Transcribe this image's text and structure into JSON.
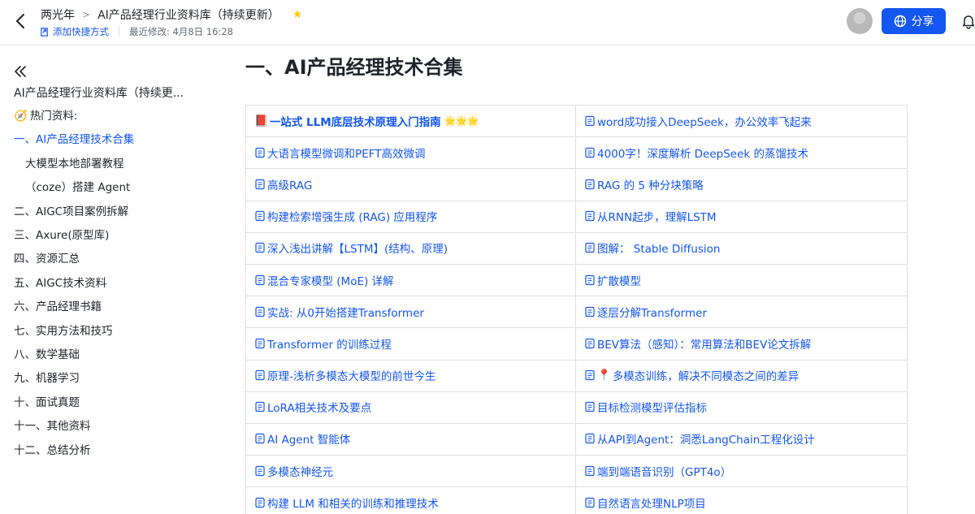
{
  "header": {
    "parent": "两光年",
    "separator": ">",
    "title": "AI产品经理行业资料库（持续更新）",
    "star": "★",
    "shortcut_label": "添加快捷方式",
    "modified": "最近修改: 4月8日 16:28",
    "share_label": "分享"
  },
  "sidebar": {
    "doc_title": "AI产品经理行业资料库（持续更...",
    "items": [
      {
        "label": "热门资料:",
        "icon": "🧭"
      },
      {
        "label": "一、AI产品经理技术合集"
      },
      {
        "label": "大模型本地部署教程"
      },
      {
        "label": "（coze）搭建 Agent"
      },
      {
        "label": "二、AIGC项目案例拆解"
      },
      {
        "label": "三、Axure(原型库)"
      },
      {
        "label": "四、资源汇总"
      },
      {
        "label": "五、AIGC技术资料"
      },
      {
        "label": "六、产品经理书籍"
      },
      {
        "label": "七、实用方法和技巧"
      },
      {
        "label": "八、数学基础"
      },
      {
        "label": "九、机器学习"
      },
      {
        "label": "十、面试真题"
      },
      {
        "label": "十一、其他资料"
      },
      {
        "label": "十二、总结分析"
      }
    ]
  },
  "main": {
    "title": "一、AI产品经理技术合集",
    "rows": [
      [
        "一站式 LLM底层技术原理入门指南",
        "word成功接入DeepSeek，办公效率飞起来"
      ],
      [
        "大语言模型微调和PEFT高效微调",
        "4000字！深度解析 DeepSeek 的蒸馏技术"
      ],
      [
        "高级RAG",
        "RAG 的 5 种分块策略"
      ],
      [
        "构建检索增强生成 (RAG) 应用程序",
        "从RNN起步，理解LSTM"
      ],
      [
        "深入浅出讲解【LSTM】(结构、原理)",
        "图解： Stable Diffusion"
      ],
      [
        "混合专家模型 (MoE) 详解",
        "扩散模型"
      ],
      [
        "实战: 从0开始搭建Transformer",
        "逐层分解Transformer"
      ],
      [
        " Transformer 的训练过程",
        "BEV算法（感知）：常用算法和BEV论文拆解"
      ],
      [
        "原理-浅析多模态大模型的前世今生",
        "多模态训练，解决不同模态之间的差异"
      ],
      [
        "LoRA相关技术及要点",
        "目标检测模型评估指标"
      ],
      [
        "AI Agent 智能体",
        "从API到Agent：洞悉LangChain工程化设计"
      ],
      [
        "多模态神经元",
        "端到端语音识别（GPT4o）"
      ],
      [
        "构建 LLM 和相关的训练和推理技术",
        "自然语言处理NLP项目"
      ]
    ],
    "first_cell_stars": "🌟🌟🌟",
    "first_cell_emoji": "📕",
    "pin_emoji": "📍"
  }
}
